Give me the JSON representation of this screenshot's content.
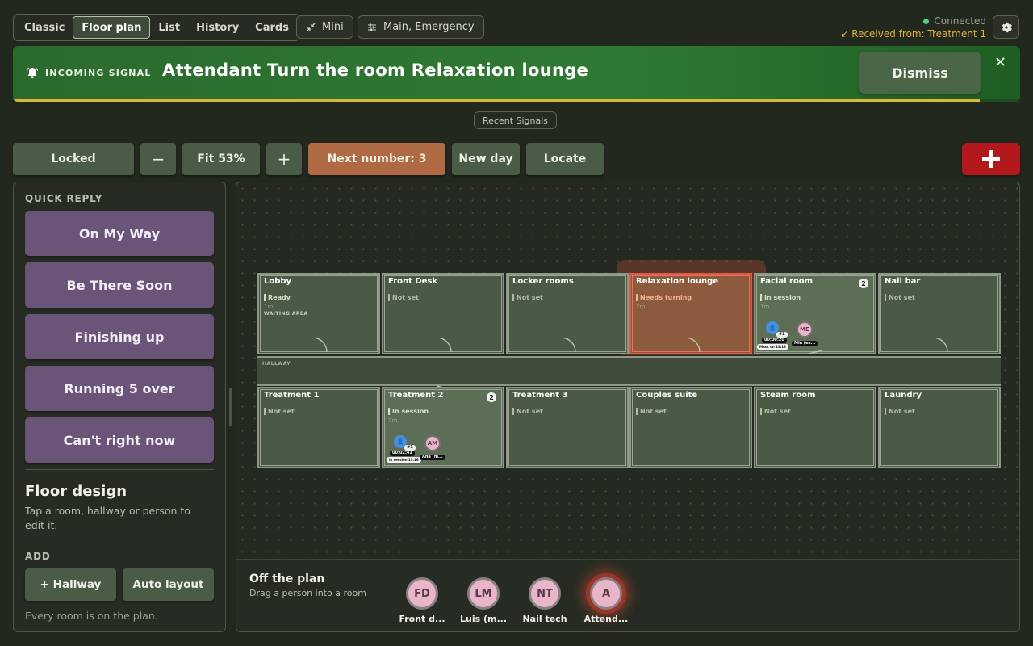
{
  "tabs": [
    "Classic",
    "Floor plan",
    "List",
    "History",
    "Cards"
  ],
  "active_tab": "Floor plan",
  "header": {
    "mini_label": "Mini",
    "channels_label": "Main, Emergency",
    "status_connected": "Connected",
    "status_received": "Received from: Treatment 1"
  },
  "banner": {
    "kicker": "INCOMING SIGNAL",
    "message": "Attendant Turn the room Relaxation lounge",
    "dismiss_label": "Dismiss",
    "close_glyph": "✕",
    "progress": 0.96
  },
  "recent_signals_label": "Recent Signals",
  "toolbar": {
    "locked_label": "Locked",
    "zoom_out": "−",
    "fit_label": "Fit 53%",
    "zoom_in": "+",
    "next_number_label": "Next number: 3",
    "new_day_label": "New day",
    "locate_label": "Locate",
    "emergency_glyph": "+"
  },
  "left_panel": {
    "quick_reply_heading": "QUICK REPLY",
    "quick_replies": [
      "On My Way",
      "Be There Soon",
      "Finishing up",
      "Running 5 over",
      "Can't right now"
    ],
    "floor_design_title": "Floor design",
    "floor_design_desc": "Tap a room, hallway or person to edit it.",
    "add_heading": "ADD",
    "add_hallway_label": "+ Hallway",
    "auto_layout_label": "Auto layout",
    "footer": "Every room is on the plan."
  },
  "floor": {
    "hallway_label": "HALLWAY",
    "rooms": [
      {
        "name": "Lobby",
        "status": "Ready",
        "time": "1m",
        "sub": "WAITING AREA"
      },
      {
        "name": "Front Desk",
        "status": "Not set"
      },
      {
        "name": "Locker rooms",
        "status": "Not set"
      },
      {
        "name": "Relaxation lounge",
        "status": "Needs turning",
        "time": "2m"
      },
      {
        "name": "Facial room",
        "status": "In session",
        "time": "1m",
        "count": "2",
        "timer": "00:00:20",
        "tag": "#2",
        "person_initials": "ME",
        "person_label": "Mia (es...",
        "note": "Mask on 13:18"
      },
      {
        "name": "Nail bar",
        "status": "Not set"
      },
      {
        "name": "Treatment 1",
        "status": "Not set"
      },
      {
        "name": "Treatment 2",
        "status": "In session",
        "time": "2m",
        "count": "2",
        "timer": "00:02:41",
        "tag": "#1",
        "person_initials": "AM",
        "person_label": "Ana (m...",
        "note": "In session 13:16"
      },
      {
        "name": "Treatment 3",
        "status": "Not set"
      },
      {
        "name": "Couples suite",
        "status": "Not set"
      },
      {
        "name": "Steam room",
        "status": "Not set"
      },
      {
        "name": "Laundry",
        "status": "Not set"
      }
    ]
  },
  "off_plan": {
    "title": "Off the plan",
    "desc": "Drag a person into a room",
    "people": [
      {
        "initials": "FD",
        "name": "Front d..."
      },
      {
        "initials": "LM",
        "name": "Luis (m..."
      },
      {
        "initials": "NT",
        "name": "Nail tech"
      },
      {
        "initials": "A",
        "name": "Attend..."
      }
    ]
  },
  "colors": {
    "banner_green": "#2f7a33",
    "quick_reply_purple": "#6a5478",
    "next_number_orange": "#b06a43",
    "emergency_red": "#b3191c",
    "signal_room": "#e05a45",
    "connected_dot": "#4fd18b"
  }
}
